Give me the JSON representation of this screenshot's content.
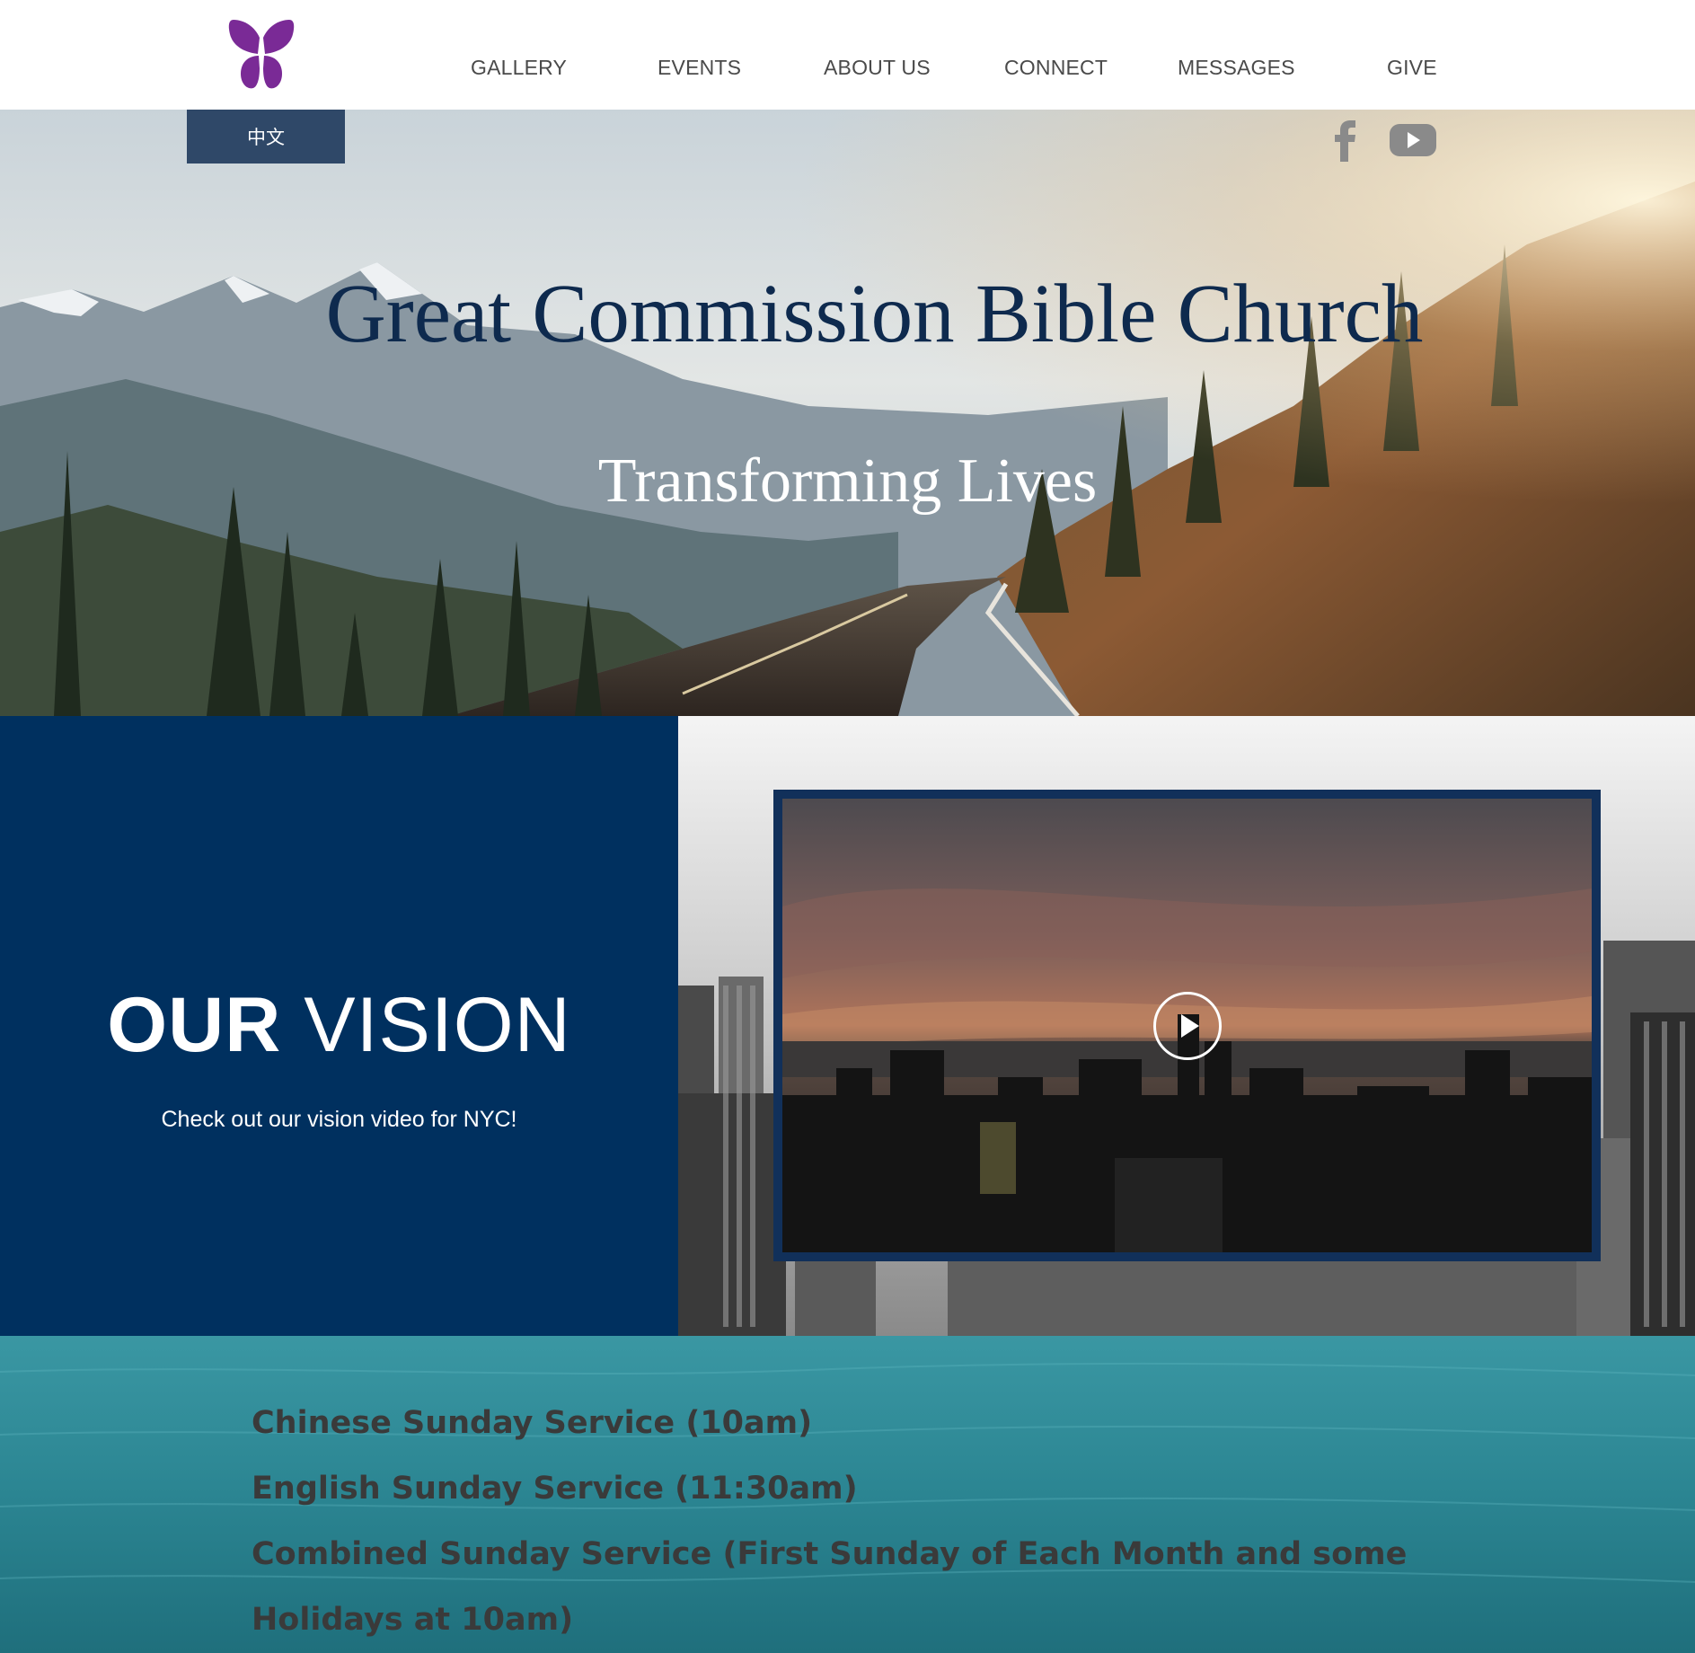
{
  "header": {
    "logo_icon": "butterfly-icon",
    "nav": [
      {
        "label": "GALLERY"
      },
      {
        "label": "EVENTS"
      },
      {
        "label": "ABOUT US"
      },
      {
        "label": "CONNECT"
      },
      {
        "label": "MESSAGES"
      },
      {
        "label": "GIVE"
      }
    ],
    "language_button": "中文",
    "social": [
      {
        "icon": "facebook-icon"
      },
      {
        "icon": "youtube-icon"
      }
    ]
  },
  "hero": {
    "title": "Great Commission Bible Church",
    "subtitle": "Transforming Lives"
  },
  "vision": {
    "heading_bold": "OUR",
    "heading_light": "VISION",
    "text": "Check out our vision video for NYC!",
    "play_icon": "play-icon"
  },
  "services": [
    {
      "text": "Chinese Sunday Service (10am)"
    },
    {
      "text": "English Sunday Service (11:30am)"
    },
    {
      "text": "Combined Sunday Service (First Sunday of Each Month and some Holidays at 10am)"
    }
  ],
  "colors": {
    "brand_purple": "#7a2a96",
    "navy": "#00305f",
    "title_navy": "#0e2a4e",
    "language_button_bg": "#2f4868",
    "nav_text": "#4a4a4a",
    "teal": "#2e8a96"
  }
}
